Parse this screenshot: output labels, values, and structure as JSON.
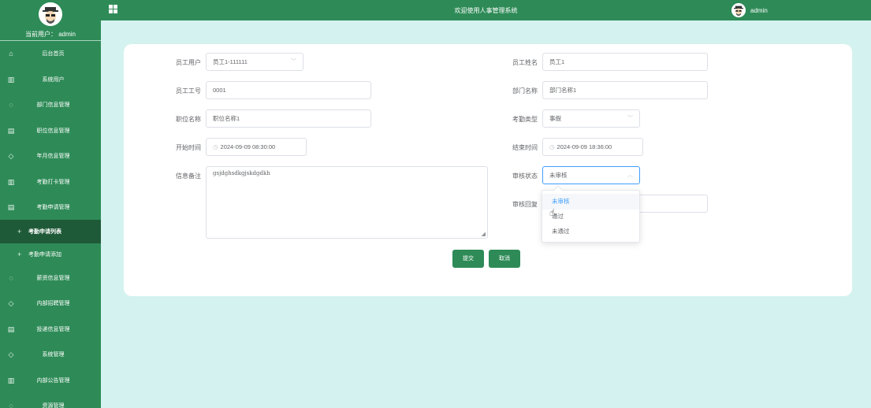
{
  "header": {
    "title": "欢迎使用人事管理系统",
    "username": "admin"
  },
  "sidebar": {
    "current_user": "当前用户：  admin",
    "items": [
      {
        "label": "后台首页",
        "icon": "home-icon"
      },
      {
        "label": "系统用户",
        "icon": "columns-icon"
      },
      {
        "label": "部门信息管理",
        "icon": "chat-icon"
      },
      {
        "label": "职位信息管理",
        "icon": "document-icon"
      },
      {
        "label": "年月信息管理",
        "icon": "shield-icon"
      },
      {
        "label": "考勤打卡管理",
        "icon": "columns-icon"
      },
      {
        "label": "考勤申请管理",
        "icon": "document-icon"
      },
      {
        "label": "考勤申请列表",
        "icon": "plus-icon"
      },
      {
        "label": "考勤申请添加",
        "icon": "plus-icon"
      },
      {
        "label": "薪资信息管理",
        "icon": "chat-icon"
      },
      {
        "label": "内部招聘管理",
        "icon": "shield-icon"
      },
      {
        "label": "投递信息管理",
        "icon": "document-icon"
      },
      {
        "label": "系统管理",
        "icon": "shield-icon"
      },
      {
        "label": "内部公告管理",
        "icon": "columns-icon"
      },
      {
        "label": "资源管理",
        "icon": "chat-icon"
      }
    ]
  },
  "form": {
    "employee_user": {
      "label": "员工用户",
      "value": "员工1-111111"
    },
    "employee_name": {
      "label": "员工姓名",
      "value": "员工1"
    },
    "employee_no": {
      "label": "员工工号",
      "value": "0001"
    },
    "dept_name": {
      "label": "部门名称",
      "value": "部门名称1"
    },
    "position_name": {
      "label": "职位名称",
      "value": "职位名称1"
    },
    "attendance_type": {
      "label": "考勤类型",
      "value": "事假"
    },
    "start_time": {
      "label": "开始时间",
      "value": "2024-09-09 08:30:00"
    },
    "end_time": {
      "label": "结束时间",
      "value": "2024-09-09 18:36:00"
    },
    "remark": {
      "label": "信息备注",
      "value": "gsjdghsdkgjskdgdkh"
    },
    "review_status": {
      "label": "审核状态",
      "value": "未审核"
    },
    "review_reply": {
      "label": "审核回复",
      "value": ""
    },
    "submit_label": "提交",
    "cancel_label": "取消"
  },
  "dropdown": {
    "options": [
      "未审核",
      "通过",
      "未通过"
    ],
    "selected_index": 0
  },
  "colors": {
    "primary": "#2e8b57",
    "active_menu": "#1f5a38",
    "background": "#d4f2ef",
    "selected_option": "#409eff"
  }
}
